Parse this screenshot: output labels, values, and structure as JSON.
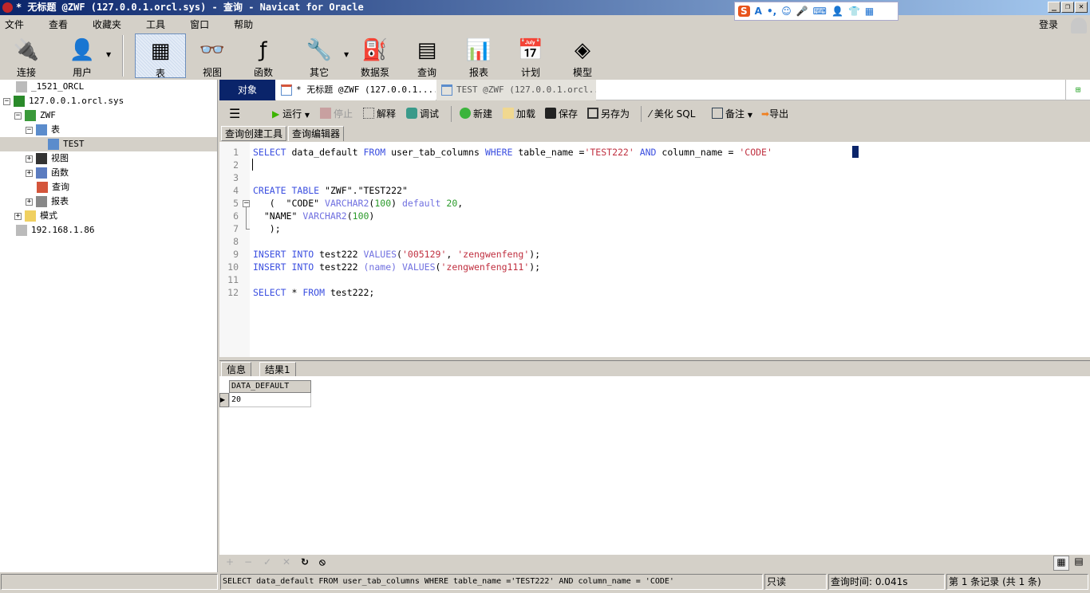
{
  "titlebar": {
    "title": "* 无标题 @ZWF (127.0.0.1.orcl.sys) - 查询 - Navicat for Oracle"
  },
  "ime": {
    "brand": "S",
    "items": [
      "A",
      "•,",
      "☺",
      "🎤",
      "⌨",
      "👤",
      "👕",
      "▦"
    ]
  },
  "menubar": {
    "items": [
      "文件",
      "查看",
      "收藏夹",
      "工具",
      "窗口",
      "帮助"
    ],
    "login": "登录"
  },
  "toolbar": {
    "items": [
      {
        "label": "连接",
        "icon": "plug-icon"
      },
      {
        "label": "用户",
        "icon": "user-icon"
      },
      {
        "label": "表",
        "icon": "table-icon",
        "active": true
      },
      {
        "label": "视图",
        "icon": "view-icon"
      },
      {
        "label": "函数",
        "icon": "function-icon"
      },
      {
        "label": "其它",
        "icon": "tools-icon"
      },
      {
        "label": "数据泵",
        "icon": "pump-icon"
      },
      {
        "label": "查询",
        "icon": "query-icon"
      },
      {
        "label": "报表",
        "icon": "report-icon"
      },
      {
        "label": "计划",
        "icon": "calendar-icon"
      },
      {
        "label": "模型",
        "icon": "model-icon"
      }
    ]
  },
  "tree": [
    {
      "label": "_1521_ORCL"
    },
    {
      "label": "127.0.0.1.orcl.sys"
    },
    {
      "label": "ZWF"
    },
    {
      "label": "表"
    },
    {
      "label": "TEST"
    },
    {
      "label": "视图"
    },
    {
      "label": "函数"
    },
    {
      "label": "查询"
    },
    {
      "label": "报表"
    },
    {
      "label": "模式"
    },
    {
      "label": "192.168.1.86"
    }
  ],
  "tabs": {
    "objects": "对象",
    "query_tab": "* 无标题 @ZWF (127.0.0.1....",
    "table_tab": "TEST @ZWF (127.0.0.1.orcl..."
  },
  "query_toolbar": {
    "run": "运行",
    "stop": "停止",
    "explain": "解释",
    "debug": "调试",
    "new": "新建",
    "load": "加载",
    "save": "保存",
    "save_as": "另存为",
    "beautify": "美化 SQL",
    "comment": "备注",
    "export": "导出"
  },
  "subtabs": [
    "查询创建工具",
    "查询编辑器"
  ],
  "editor": {
    "lines": [
      [
        {
          "t": "SELECT",
          "c": "kw"
        },
        {
          "t": " data_default ",
          "c": "id"
        },
        {
          "t": "FROM",
          "c": "kw"
        },
        {
          "t": " user_tab_columns ",
          "c": "id"
        },
        {
          "t": "WHERE",
          "c": "kw"
        },
        {
          "t": " table_name =",
          "c": "id"
        },
        {
          "t": "'TEST222'",
          "c": "str"
        },
        {
          "t": " ",
          "c": "id"
        },
        {
          "t": "AND",
          "c": "kw"
        },
        {
          "t": " column_name = ",
          "c": "id"
        },
        {
          "t": "'CODE'",
          "c": "str"
        }
      ],
      [],
      [],
      [
        {
          "t": "CREATE",
          "c": "kw"
        },
        {
          "t": " ",
          "c": "id"
        },
        {
          "t": "TABLE",
          "c": "kw"
        },
        {
          "t": " \"ZWF\".\"TEST222\"",
          "c": "id"
        }
      ],
      [
        {
          "t": "   (  \"CODE\" ",
          "c": "id"
        },
        {
          "t": "VARCHAR2",
          "c": "fn"
        },
        {
          "t": "(",
          "c": "id"
        },
        {
          "t": "100",
          "c": "num"
        },
        {
          "t": ") ",
          "c": "id"
        },
        {
          "t": "default",
          "c": "fn"
        },
        {
          "t": " ",
          "c": "id"
        },
        {
          "t": "20",
          "c": "num"
        },
        {
          "t": ",",
          "c": "id"
        }
      ],
      [
        {
          "t": "  \"NAME\" ",
          "c": "id"
        },
        {
          "t": "VARCHAR2",
          "c": "fn"
        },
        {
          "t": "(",
          "c": "id"
        },
        {
          "t": "100",
          "c": "num"
        },
        {
          "t": ")",
          "c": "id"
        }
      ],
      [
        {
          "t": "   );",
          "c": "id"
        }
      ],
      [],
      [
        {
          "t": "INSERT",
          "c": "kw"
        },
        {
          "t": " ",
          "c": "id"
        },
        {
          "t": "INTO",
          "c": "kw"
        },
        {
          "t": " test222 ",
          "c": "id"
        },
        {
          "t": "VALUES",
          "c": "fn"
        },
        {
          "t": "(",
          "c": "id"
        },
        {
          "t": "'005129'",
          "c": "str"
        },
        {
          "t": ", ",
          "c": "id"
        },
        {
          "t": "'zengwenfeng'",
          "c": "str"
        },
        {
          "t": ");",
          "c": "id"
        }
      ],
      [
        {
          "t": "INSERT",
          "c": "kw"
        },
        {
          "t": " ",
          "c": "id"
        },
        {
          "t": "INTO",
          "c": "kw"
        },
        {
          "t": " test222 ",
          "c": "id"
        },
        {
          "t": "(name)",
          "c": "fn"
        },
        {
          "t": " ",
          "c": "id"
        },
        {
          "t": "VALUES",
          "c": "fn"
        },
        {
          "t": "(",
          "c": "id"
        },
        {
          "t": "'zengwenfeng111'",
          "c": "str"
        },
        {
          "t": ");",
          "c": "id"
        }
      ],
      [],
      [
        {
          "t": "SELECT",
          "c": "kw"
        },
        {
          "t": " * ",
          "c": "id"
        },
        {
          "t": "FROM",
          "c": "kw"
        },
        {
          "t": " test222;",
          "c": "id"
        }
      ]
    ]
  },
  "result_tabs": [
    "信息",
    "结果1"
  ],
  "grid": {
    "columns": [
      "DATA_DEFAULT"
    ],
    "rows": [
      [
        "20"
      ]
    ]
  },
  "status": {
    "sql": "SELECT data_default FROM user_tab_columns WHERE table_name ='TEST222' AND column_name = 'CODE'",
    "readonly": "只读",
    "query_time": "查询时间: 0.041s",
    "records": "第 1 条记录 (共 1 条)"
  },
  "colors": {
    "title_start": "#0a246a",
    "objects_tab": "#0a246a",
    "keyword": "#3b4fe0",
    "string": "#c03040",
    "number": "#2a9a2a"
  }
}
